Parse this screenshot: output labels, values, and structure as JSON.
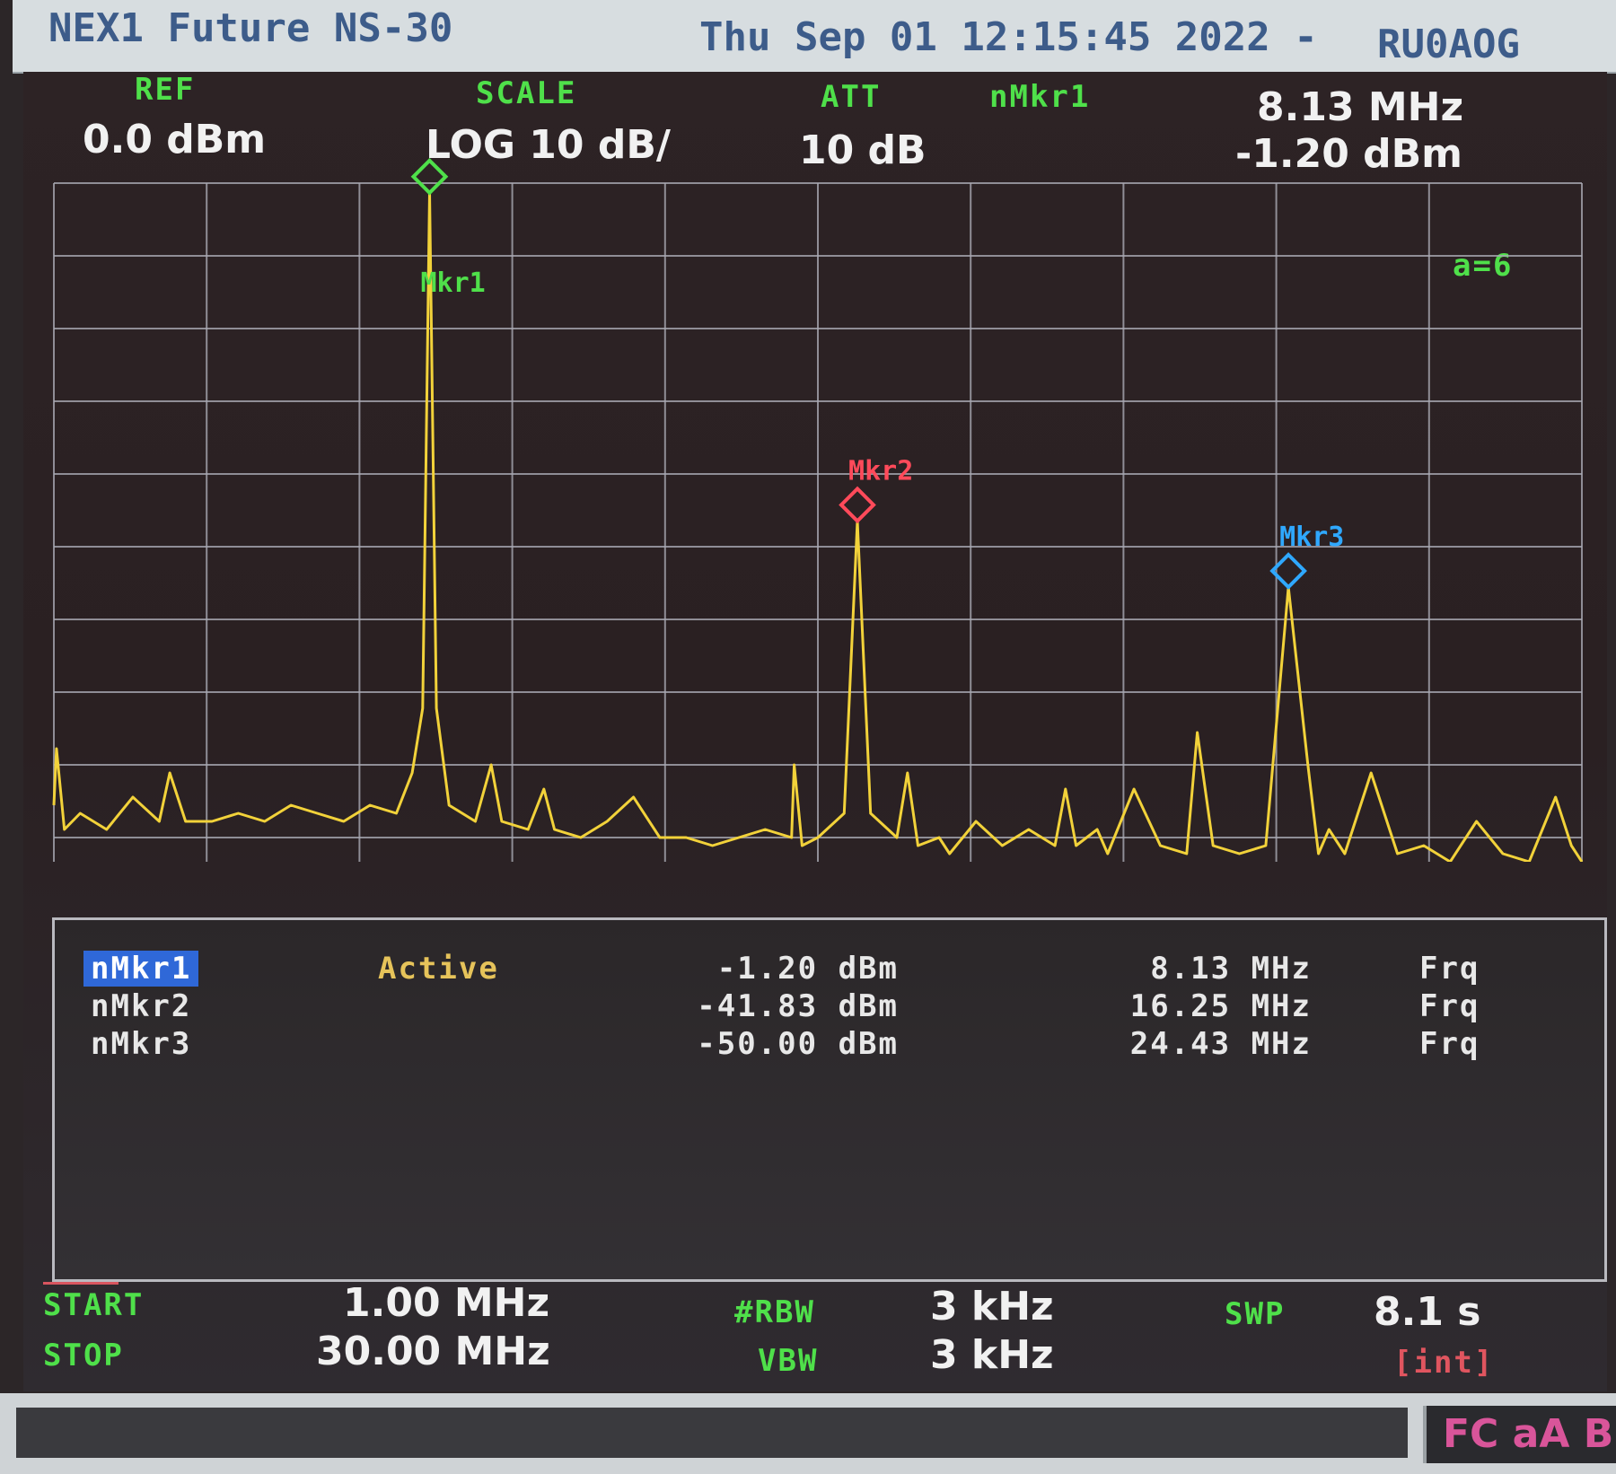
{
  "header": {
    "instrument": "NEX1 Future NS-30",
    "datetime": "Thu Sep 01 12:15:45 2022 -",
    "callsign": "RU0AOG"
  },
  "params": {
    "ref_label": "REF",
    "ref_value": "0.0 dBm",
    "scale_label": "SCALE",
    "scale_value": "LOG 10 dB/",
    "att_label": "ATT",
    "att_value": "10 dB",
    "active_marker_label": "nMkr1",
    "active_marker_freq": "8.13 MHz",
    "active_marker_amp": "-1.20 dBm",
    "avg_indicator": "a=6"
  },
  "colors": {
    "trace": "#f2d23a",
    "grid": "#a9a9b3",
    "label_green": "#4fe04a",
    "marker1": "#4fe04a",
    "marker2": "#ff4a5a",
    "marker3": "#2fa8ff",
    "active_highlight": "#2f68d8"
  },
  "markers": [
    {
      "name": "nMkr1",
      "label": "Mkr1",
      "status": "Active",
      "amplitude": "-1.20 dBm",
      "frequency": "8.13 MHz",
      "mode": "Frq",
      "freq_mhz": 8.13,
      "amp_dbm": -1.2,
      "active": true
    },
    {
      "name": "nMkr2",
      "label": "Mkr2",
      "status": "",
      "amplitude": "-41.83 dBm",
      "frequency": "16.25 MHz",
      "mode": "Frq",
      "freq_mhz": 16.25,
      "amp_dbm": -41.83,
      "active": false
    },
    {
      "name": "nMkr3",
      "label": "Mkr3",
      "status": "",
      "amplitude": "-50.00 dBm",
      "frequency": "24.43 MHz",
      "mode": "Frq",
      "freq_mhz": 24.43,
      "amp_dbm": -50.0,
      "active": false
    }
  ],
  "footer": {
    "start_label": "START",
    "start_value": "1.00 MHz",
    "stop_label": "STOP",
    "stop_value": "30.00 MHz",
    "rbw_label": "#RBW",
    "rbw_value": "3 kHz",
    "vbw_label": "VBW",
    "vbw_value": "3 kHz",
    "swp_label": "SWP",
    "swp_value": "8.1 s",
    "swp_mode": "[int]",
    "status_flags": "FC aA B"
  },
  "chart_data": {
    "type": "line",
    "xlim": [
      1.0,
      30.0
    ],
    "ylim": [
      -90,
      0
    ],
    "grid": true,
    "series": [
      {
        "x": [
          1.0,
          1.05,
          1.2,
          1.5,
          2.0,
          2.5,
          3.0,
          3.2,
          3.5,
          4.0,
          4.5,
          5.0,
          5.5,
          6.0,
          6.5,
          7.0,
          7.5,
          7.8,
          8.0,
          8.13,
          8.26,
          8.5,
          9.0,
          9.3,
          9.5,
          10.0,
          10.3,
          10.5,
          11.0,
          11.5,
          12.0,
          12.5,
          13.0,
          13.5,
          14.0,
          14.5,
          15.0,
          15.05,
          15.2,
          15.5,
          16.0,
          16.25,
          16.5,
          17.0,
          17.2,
          17.4,
          17.8,
          18.0,
          18.5,
          19.0,
          19.5,
          20.0,
          20.2,
          20.4,
          20.8,
          21.0,
          21.5,
          22.0,
          22.5,
          22.7,
          23.0,
          23.5,
          24.0,
          24.43,
          24.8,
          25.0,
          25.2,
          25.5,
          26.0,
          26.5,
          27.0,
          27.5,
          28.0,
          28.5,
          29.0,
          29.5,
          29.8,
          30.0
        ],
        "y": [
          -77,
          -70,
          -80,
          -78,
          -80,
          -76,
          -79,
          -73,
          -79,
          -79,
          -78,
          -79,
          -77,
          -78,
          -79,
          -77,
          -78,
          -73,
          -65,
          -1.2,
          -65,
          -77,
          -79,
          -72,
          -79,
          -80,
          -75,
          -80,
          -81,
          -79,
          -76,
          -81,
          -81,
          -82,
          -81,
          -80,
          -81,
          -72,
          -82,
          -81,
          -78,
          -41.83,
          -78,
          -81,
          -73,
          -82,
          -81,
          -83,
          -79,
          -82,
          -80,
          -82,
          -75,
          -82,
          -80,
          -83,
          -75,
          -82,
          -83,
          -68,
          -82,
          -83,
          -82,
          -50.0,
          -72,
          -83,
          -80,
          -83,
          -73,
          -83,
          -82,
          -84,
          -79,
          -83,
          -84,
          -76,
          -82,
          -84
        ]
      }
    ]
  }
}
